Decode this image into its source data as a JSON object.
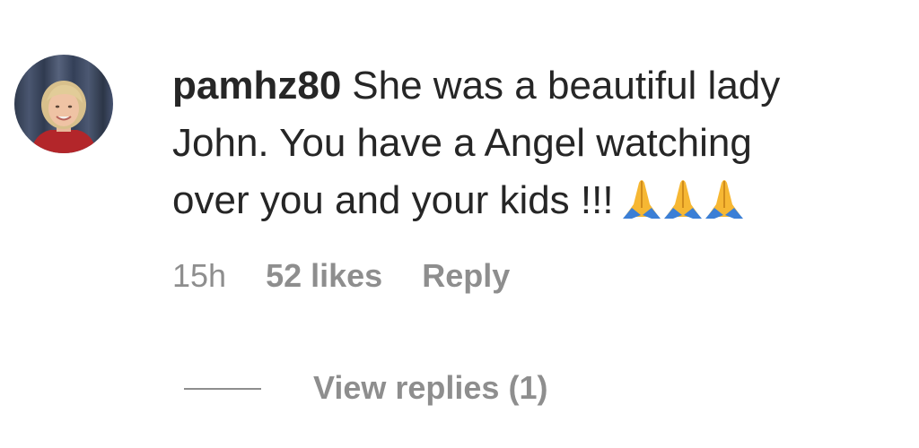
{
  "comment": {
    "username": "pamhz80",
    "text_line1": "She was a beautiful lady",
    "text_line2": "John. You have a Angel watching",
    "text_line3": "over you and your kids !!!",
    "emoji_icon": "folded-hands-emoji",
    "emoji_count": 3,
    "time": "15h",
    "likes": "52 likes",
    "reply_label": "Reply",
    "view_replies_label": "View replies (1)"
  },
  "colors": {
    "text": "#262626",
    "secondary": "#8e8e8e",
    "background": "#ffffff"
  }
}
